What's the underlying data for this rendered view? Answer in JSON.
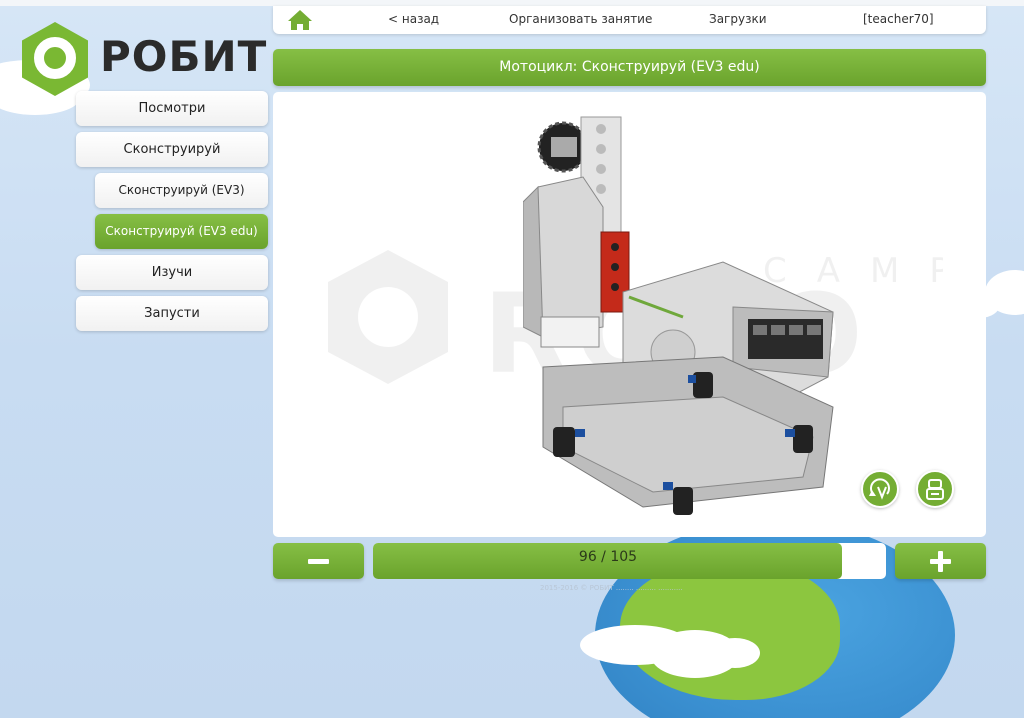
{
  "logo": {
    "text": "РОБИТ"
  },
  "topnav": {
    "back": "< назад",
    "organize": "Организовать занятие",
    "downloads": "Загрузки",
    "user": "[teacher70]"
  },
  "title": "Мотоцикл: Сконструируй (EV3 edu)",
  "sidebar": {
    "items": [
      {
        "label": "Посмотри"
      },
      {
        "label": "Сконструируй"
      },
      {
        "label": "Сконструируй (EV3)"
      },
      {
        "label": "Сконструируй (EV3 edu)"
      },
      {
        "label": "Изучи"
      },
      {
        "label": "Запусти"
      }
    ]
  },
  "pager": {
    "current": 96,
    "total": 105,
    "text": "96 / 105",
    "progress_fraction": 0.914
  },
  "watermark": {
    "top": "CAMP",
    "main": "ROBO"
  },
  "footer": "2015-2016 © РОБИТ ........ ......... ...........",
  "colors": {
    "accent": "#7ab833",
    "accent_dark": "#6aa32c"
  },
  "icons": [
    "home-icon",
    "rotate-icon",
    "robot-icon",
    "minus-icon",
    "plus-icon"
  ]
}
